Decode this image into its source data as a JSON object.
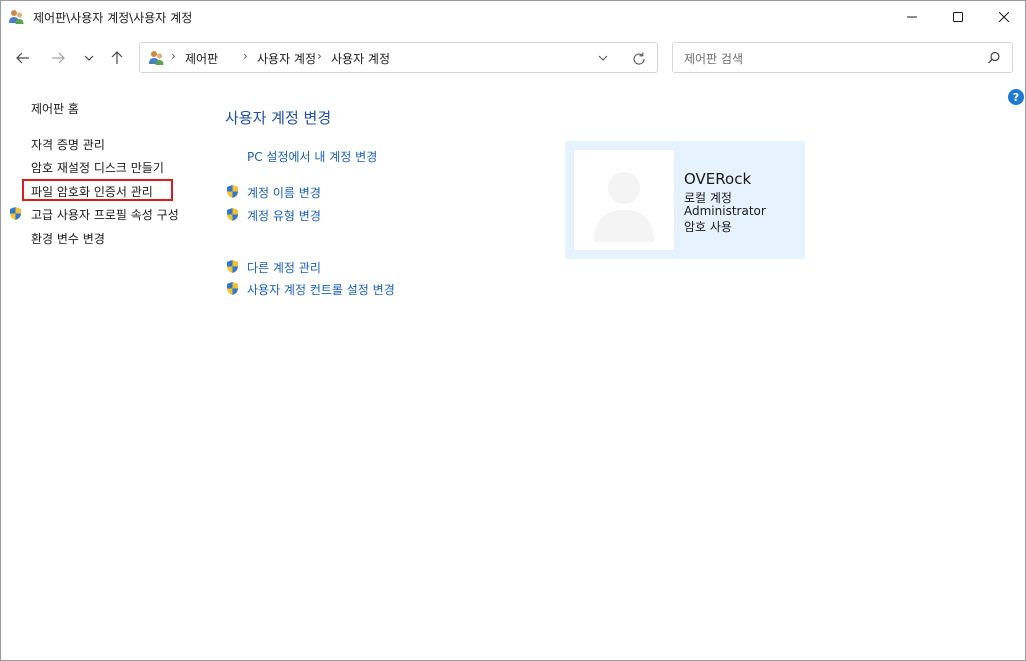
{
  "window": {
    "title": "제어판\\사용자 계정\\사용자 계정"
  },
  "address": {
    "crumbs": [
      "제어판",
      "사용자 계정",
      "사용자 계정"
    ]
  },
  "search": {
    "placeholder": "제어판 검색"
  },
  "help": {
    "label": "?"
  },
  "sidebar": {
    "home": "제어판 홈",
    "items": [
      {
        "label": "자격 증명 관리",
        "shield": false
      },
      {
        "label": "암호 재설정 디스크 만들기",
        "shield": false
      },
      {
        "label": "파일 암호화 인증서 관리",
        "shield": false,
        "highlighted": true
      },
      {
        "label": "고급 사용자 프로필 속성 구성",
        "shield": true
      },
      {
        "label": "환경 변수 변경",
        "shield": false
      }
    ]
  },
  "main": {
    "title": "사용자 계정 변경",
    "pc_settings_link": "PC 설정에서 내 계정 변경",
    "links": [
      {
        "label": "계정 이름 변경",
        "shield": true
      },
      {
        "label": "계정 유형 변경",
        "shield": true
      }
    ],
    "links2": [
      {
        "label": "다른 계정 관리",
        "shield": true
      },
      {
        "label": "사용자 계정 컨트롤 설정 변경",
        "shield": true
      }
    ]
  },
  "user": {
    "name": "OVERock",
    "account_type": "로컬 계정",
    "role": "Administrator",
    "password": "암호 사용"
  },
  "colors": {
    "link": "#1a5fb4",
    "title": "#1e4fa3",
    "card_bg": "#e6f2fd",
    "highlight_border": "#d81e1e"
  }
}
